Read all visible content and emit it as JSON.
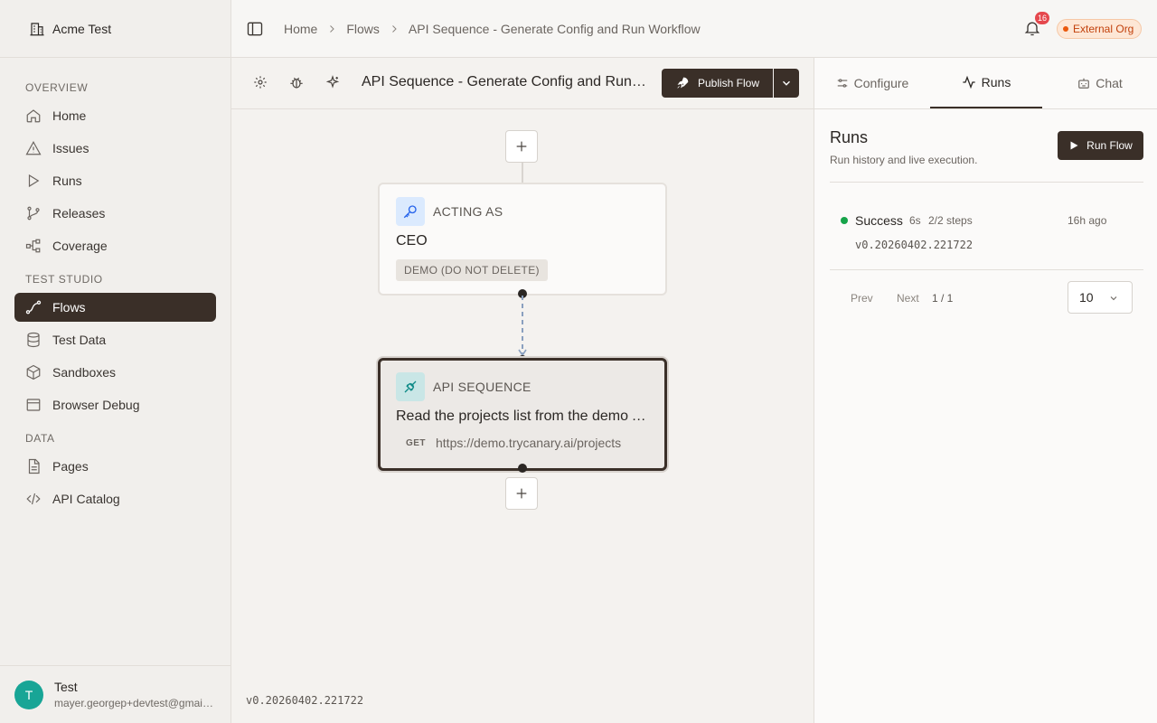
{
  "org": {
    "name": "Acme Test",
    "icon": "building-icon"
  },
  "sidebar": {
    "sections": [
      {
        "title": "OVERVIEW",
        "items": [
          {
            "label": "Home",
            "icon": "home-icon"
          },
          {
            "label": "Issues",
            "icon": "alert-triangle-icon"
          },
          {
            "label": "Runs",
            "icon": "play-icon"
          },
          {
            "label": "Releases",
            "icon": "git-branch-icon"
          },
          {
            "label": "Coverage",
            "icon": "network-icon"
          }
        ]
      },
      {
        "title": "TEST STUDIO",
        "items": [
          {
            "label": "Flows",
            "icon": "flow-icon",
            "active": true
          },
          {
            "label": "Test Data",
            "icon": "database-icon"
          },
          {
            "label": "Sandboxes",
            "icon": "box-icon"
          },
          {
            "label": "Browser Debug",
            "icon": "browser-icon"
          }
        ]
      },
      {
        "title": "DATA",
        "items": [
          {
            "label": "Pages",
            "icon": "file-icon"
          },
          {
            "label": "API Catalog",
            "icon": "code-icon"
          }
        ]
      }
    ]
  },
  "user": {
    "initial": "T",
    "name": "Test",
    "email": "mayer.georgep+devtest@gmail.com"
  },
  "topbar": {
    "breadcrumb": [
      "Home",
      "Flows",
      "API Sequence - Generate Config and Run Workflow"
    ],
    "notifications": "16",
    "org_badge": "External Org"
  },
  "flow": {
    "title": "API Sequence - Generate Config and Run Workflow",
    "publish_label": "Publish Flow",
    "version": "v0.20260402.221722"
  },
  "nodes": {
    "acting": {
      "header": "ACTING AS",
      "title": "CEO",
      "tag": "DEMO (DO NOT DELETE)"
    },
    "api": {
      "header": "API SEQUENCE",
      "title": "Read the projects list from the demo API",
      "method": "GET",
      "url": "https://demo.trycanary.ai/projects"
    }
  },
  "panel": {
    "tabs": [
      "Configure",
      "Runs",
      "Chat"
    ],
    "active_tab": "Runs",
    "heading": "Runs",
    "subtitle": "Run history and live execution.",
    "run_button": "Run Flow",
    "runs": [
      {
        "status": "Success",
        "duration": "6s",
        "steps": "2/2 steps",
        "ago": "16h ago",
        "version": "v0.20260402.221722"
      }
    ],
    "pager": {
      "prev": "Prev",
      "next": "Next",
      "page": "1 / 1",
      "size": "10"
    }
  },
  "colors": {
    "accent": "#3a2f28",
    "success": "#16a34a",
    "badge": "#e5484d",
    "org_badge": "#ea580c"
  }
}
